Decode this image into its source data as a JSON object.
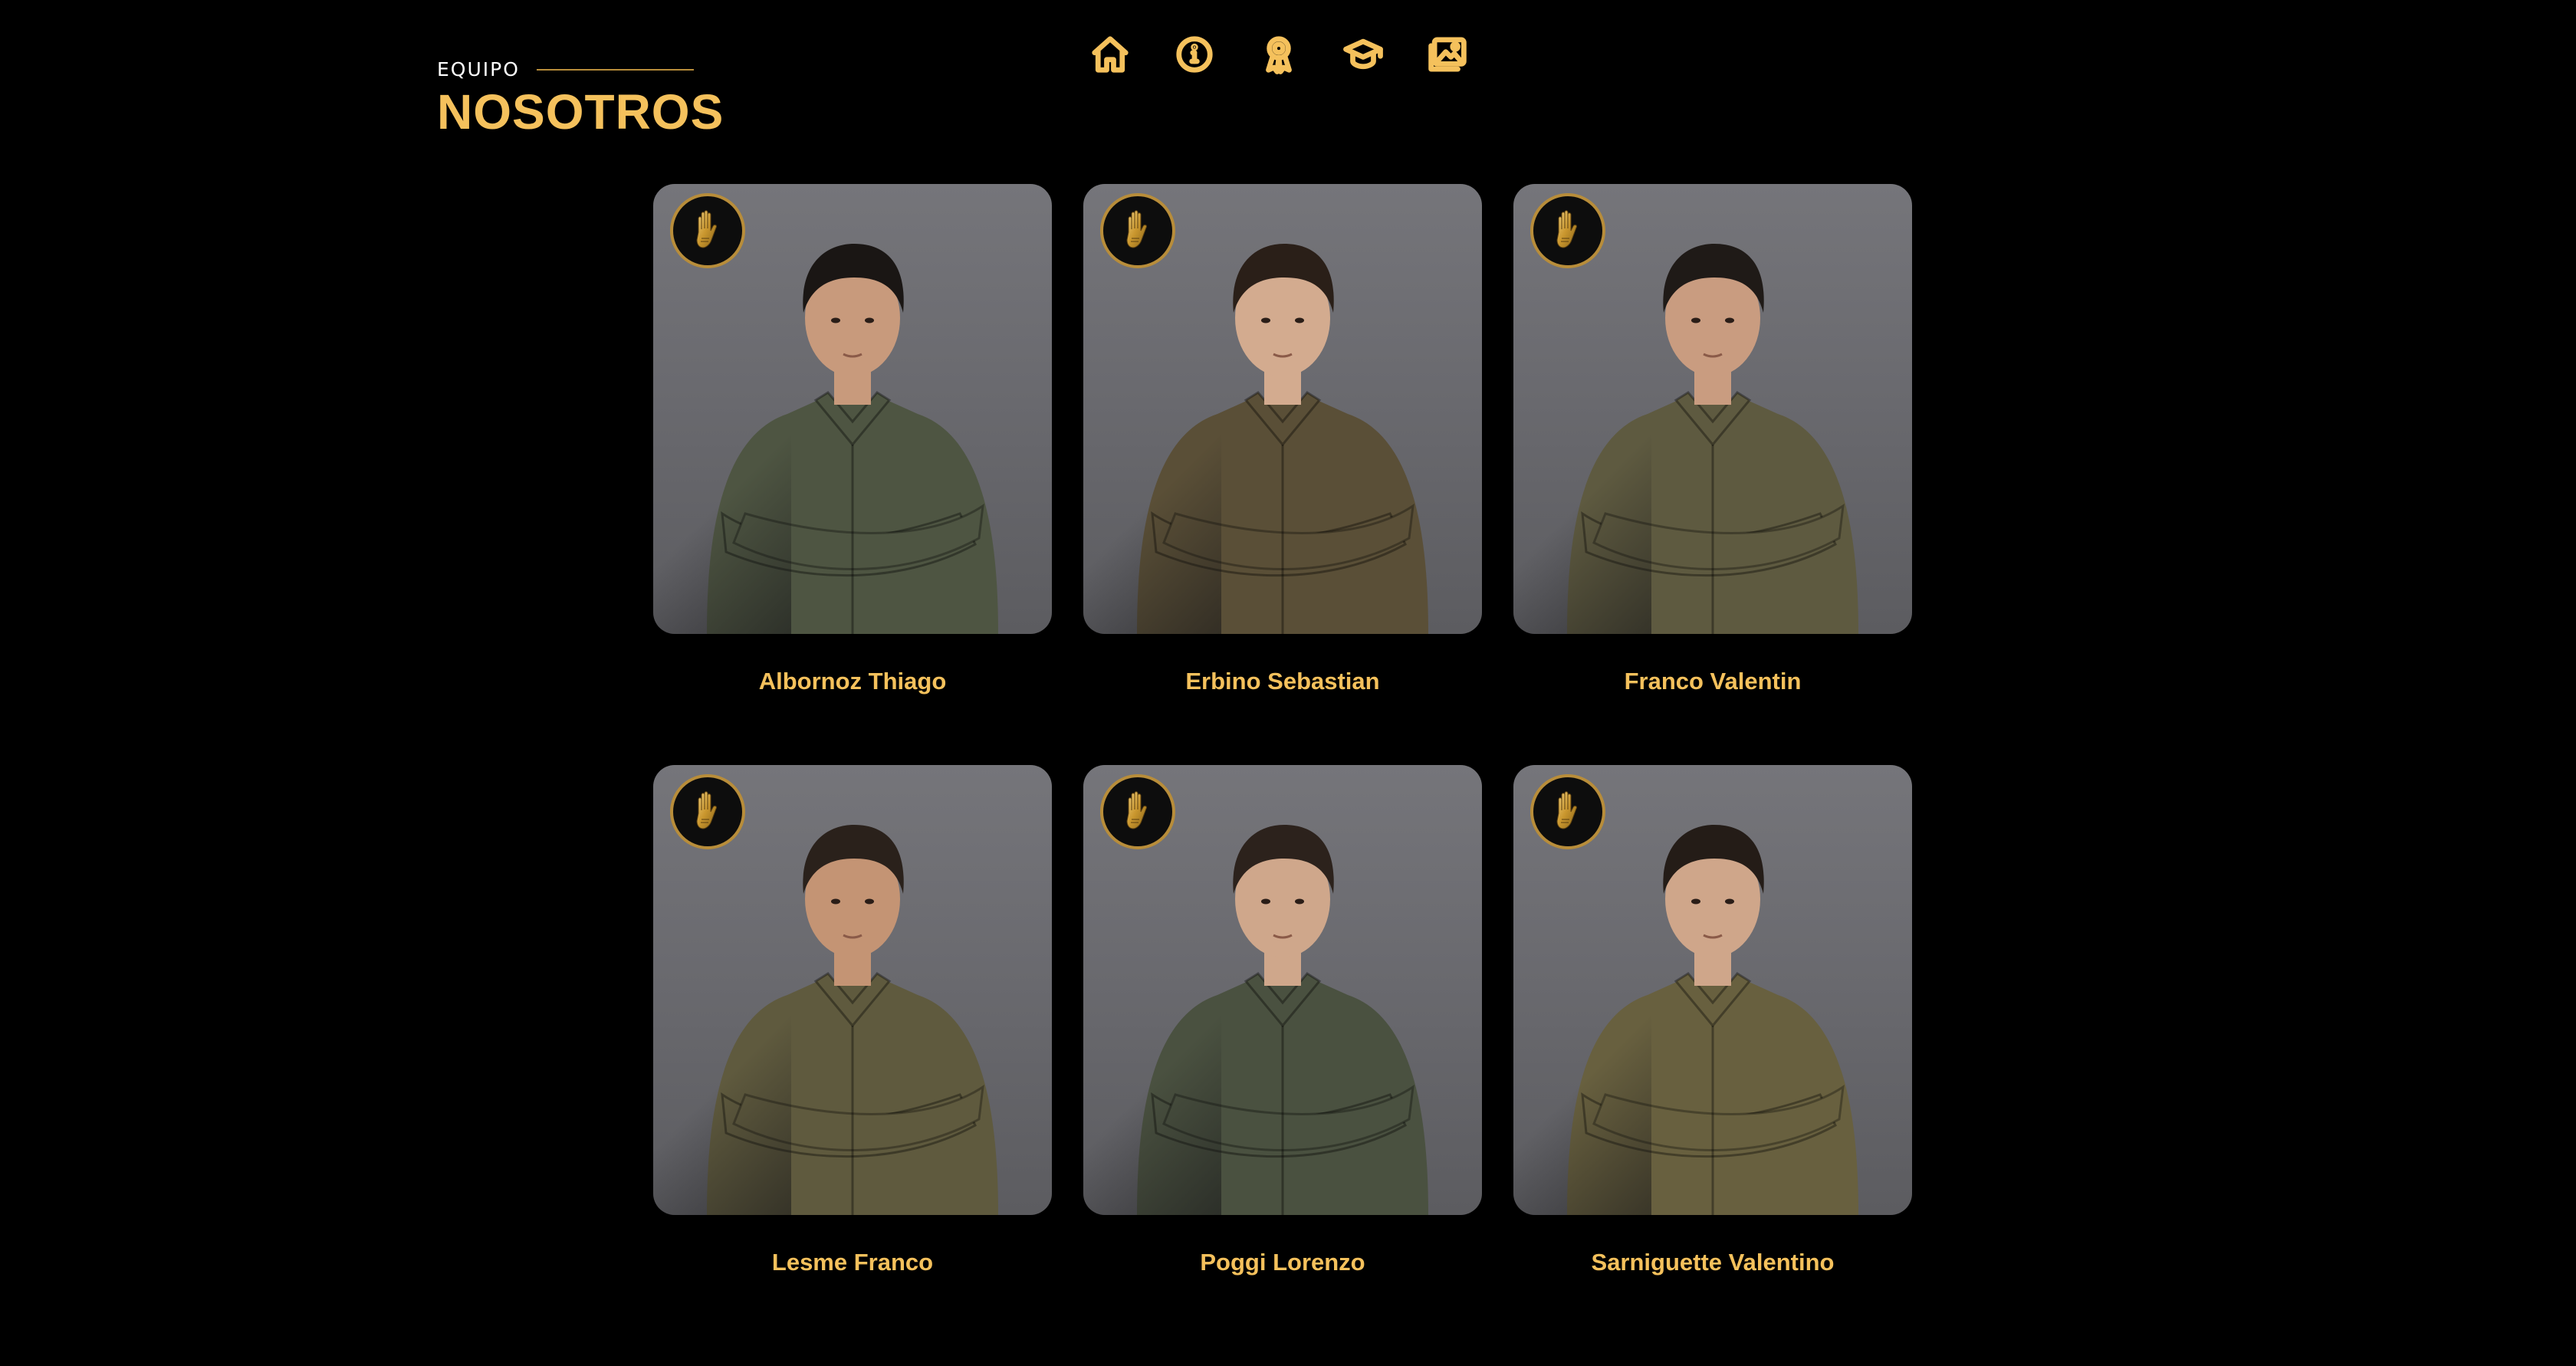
{
  "header": {
    "eyebrow": "EQUIPO",
    "title": "NOSOTROS"
  },
  "nav": [
    {
      "icon": "home-icon",
      "label": "Inicio"
    },
    {
      "icon": "info-icon",
      "label": "Información"
    },
    {
      "icon": "award-icon",
      "label": "Logros"
    },
    {
      "icon": "graduation-cap-icon",
      "label": "Educación"
    },
    {
      "icon": "gallery-icon",
      "label": "Galería"
    }
  ],
  "team": [
    {
      "name": "Albornoz Thiago",
      "jacket": "#4e5542",
      "hair": "#1a1614",
      "skin": "#c89a7c"
    },
    {
      "name": "Erbino Sebastian",
      "jacket": "#5a4f37",
      "hair": "#2a1f18",
      "skin": "#d3ab8f"
    },
    {
      "name": "Franco Valentin",
      "jacket": "#5e5a40",
      "hair": "#1f1a17",
      "skin": "#c99c80"
    },
    {
      "name": "Lesme Franco",
      "jacket": "#5f5a3e",
      "hair": "#2a211b",
      "skin": "#c49474"
    },
    {
      "name": "Poggi Lorenzo",
      "jacket": "#4a5140",
      "hair": "#2c221c",
      "skin": "#cfa78b"
    },
    {
      "name": "Sarniguette Valentino",
      "jacket": "#68603f",
      "hair": "#241c17",
      "skin": "#cfa68a"
    }
  ],
  "colors": {
    "background": "#000000",
    "accent": "#f5c15c",
    "accent_dark": "#b88d3a"
  }
}
